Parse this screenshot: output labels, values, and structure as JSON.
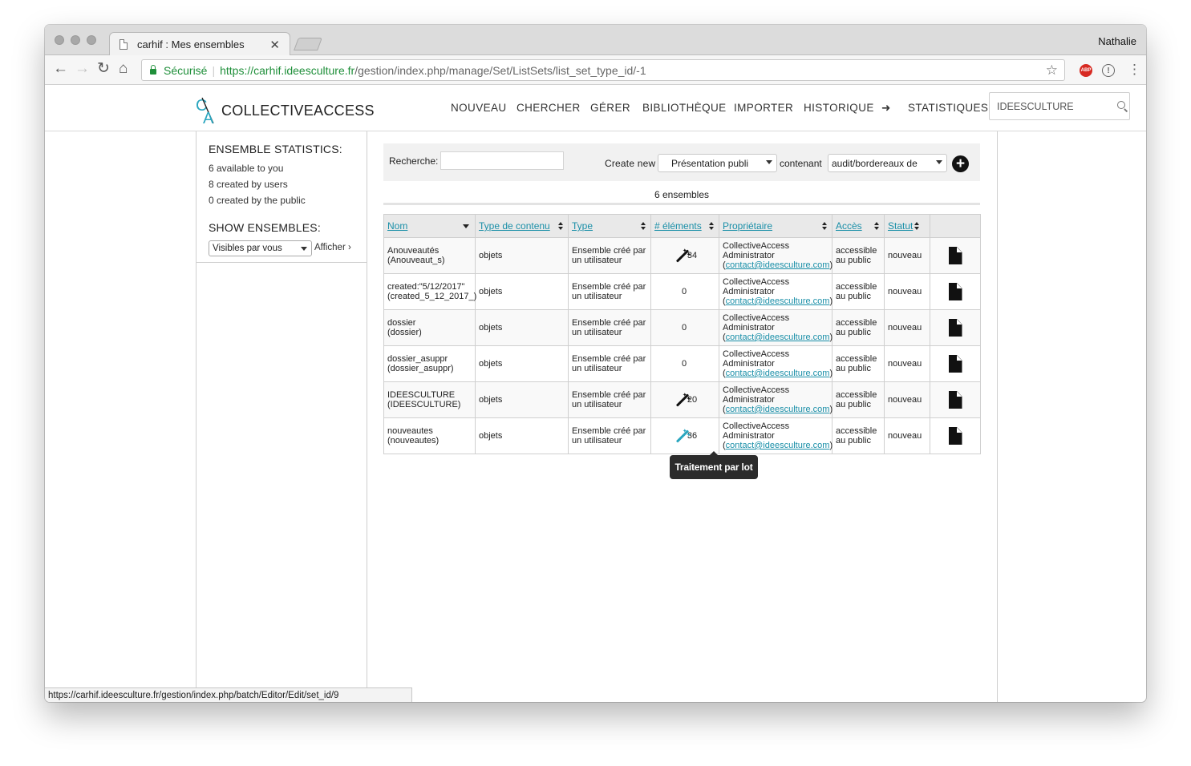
{
  "browser": {
    "tab_title": "carhif : Mes ensembles",
    "profile_name": "Nathalie",
    "secure_label": "Sécurisé",
    "url_scheme_host": "https://carhif.ideesculture.fr",
    "url_path": "/gestion/index.php/manage/Set/ListSets/list_set_type_id/-1",
    "abp_label": "ABP",
    "status_url": "https://carhif.ideesculture.fr/gestion/index.php/batch/Editor/Edit/set_id/9"
  },
  "app": {
    "logo_text": "COLLECTIVEACCESS",
    "nav": [
      "NOUVEAU",
      "CHERCHER",
      "GÉRER",
      "BIBLIOTHÈQUE",
      "IMPORTER",
      "HISTORIQUE",
      "➜",
      "STATISTIQUES"
    ],
    "search_value": "IDEESCULTURE"
  },
  "sidebar": {
    "stats_title": "ENSEMBLE STATISTICS:",
    "stats": [
      "6 available to you",
      "8 created by users",
      "0 created by the public"
    ],
    "show_title": "SHOW ENSEMBLES:",
    "visibility_value": "Visibles par vous",
    "afficher_label": "Afficher ›"
  },
  "toolbar": {
    "search_label": "Recherche:",
    "search_value": "",
    "create_label": "Create new",
    "create_type_value": "Présentation publi",
    "contenant_label": "contenant",
    "contenant_value": "audit/bordereaux de",
    "add_symbol": "+"
  },
  "listing": {
    "count_text": "6 ensembles",
    "columns": [
      "Nom",
      "Type de contenu",
      "Type",
      "# éléments",
      "Propriétaire",
      "Accès",
      "Statut",
      ""
    ],
    "rows": [
      {
        "name": "Anouveautés",
        "code": "(Anouveaut_s)",
        "content_type": "objets",
        "type_line1": "Ensemble créé par",
        "type_line2": "un utilisateur",
        "count": "34",
        "has_batch": true,
        "owner_line1": "CollectiveAccess",
        "owner_line2": "Administrator",
        "owner_email": "contact@ideesculture.com",
        "access_line1": "accessible",
        "access_line2": "au public",
        "status": "nouveau"
      },
      {
        "name": "created:\"5/12/2017\"",
        "code": "(created_5_12_2017_)",
        "content_type": "objets",
        "type_line1": "Ensemble créé par",
        "type_line2": "un utilisateur",
        "count": "0",
        "has_batch": false,
        "owner_line1": "CollectiveAccess",
        "owner_line2": "Administrator",
        "owner_email": "contact@ideesculture.com",
        "access_line1": "accessible",
        "access_line2": "au public",
        "status": "nouveau"
      },
      {
        "name": "dossier",
        "code": "(dossier)",
        "content_type": "objets",
        "type_line1": "Ensemble créé par",
        "type_line2": "un utilisateur",
        "count": "0",
        "has_batch": false,
        "owner_line1": "CollectiveAccess",
        "owner_line2": "Administrator",
        "owner_email": "contact@ideesculture.com",
        "access_line1": "accessible",
        "access_line2": "au public",
        "status": "nouveau"
      },
      {
        "name": "dossier_asuppr",
        "code": "(dossier_asuppr)",
        "content_type": "objets",
        "type_line1": "Ensemble créé par",
        "type_line2": "un utilisateur",
        "count": "0",
        "has_batch": false,
        "owner_line1": "CollectiveAccess",
        "owner_line2": "Administrator",
        "owner_email": "contact@ideesculture.com",
        "access_line1": "accessible",
        "access_line2": "au public",
        "status": "nouveau"
      },
      {
        "name": "IDEESCULTURE",
        "code": "(IDEESCULTURE)",
        "content_type": "objets",
        "type_line1": "Ensemble créé par",
        "type_line2": "un utilisateur",
        "count": "20",
        "has_batch": true,
        "owner_line1": "CollectiveAccess",
        "owner_line2": "Administrator",
        "owner_email": "contact@ideesculture.com",
        "access_line1": "accessible",
        "access_line2": "au public",
        "status": "nouveau"
      },
      {
        "name": "nouveautes",
        "code": "(nouveautes)",
        "content_type": "objets",
        "type_line1": "Ensemble créé par",
        "type_line2": "un utilisateur",
        "count": "36",
        "has_batch": true,
        "batch_hover": true,
        "owner_line1": "CollectiveAccess",
        "owner_line2": "Administrator",
        "owner_email": "contact@ideesculture.com",
        "access_line1": "accessible",
        "access_line2": "au public",
        "status": "nouveau"
      }
    ],
    "tooltip": "Traitement par lot"
  },
  "colors": {
    "link": "#1a8fa8",
    "secure_green": "#1f8f3a",
    "wand_hover": "#2aa6bf",
    "abp_red": "#d72a22"
  }
}
